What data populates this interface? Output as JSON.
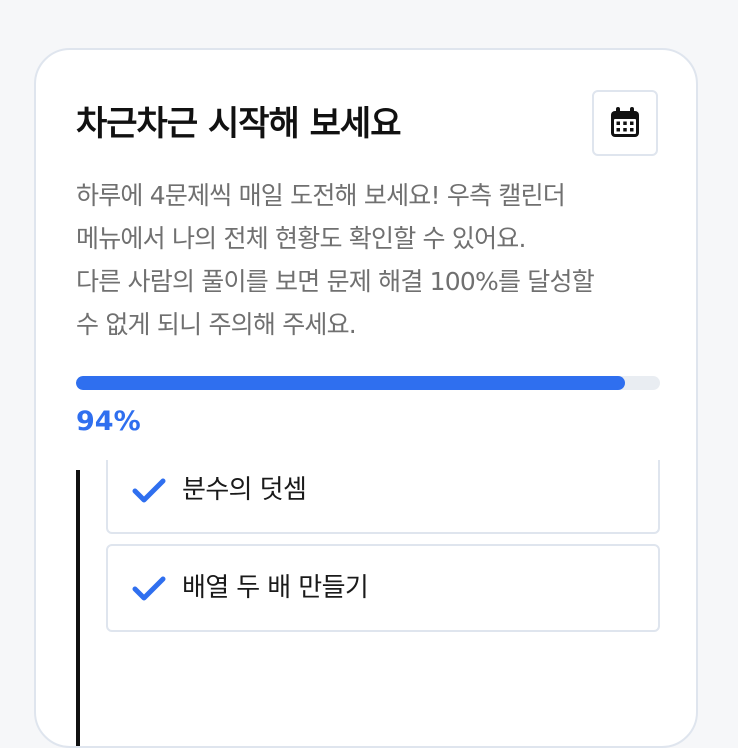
{
  "card": {
    "title": "차근차근 시작해 보세요",
    "calendar_icon": "calendar-icon",
    "description_lines": [
      "하루에 4문제씩 매일 도전해 보세요! 우측 캘린더",
      "메뉴에서 나의 전체 현황도 확인할 수 있어요.",
      "다른 사람의 풀이를 보면 문제 해결 100%를 달성할",
      "수 없게 되니 주의해 주세요."
    ],
    "progress": {
      "value_percent": 94,
      "label": "94%"
    },
    "items": [
      {
        "label": "분수의 덧셈",
        "status": "done"
      },
      {
        "label": "배열 두 배 만들기",
        "status": "done"
      }
    ]
  },
  "colors": {
    "accent": "#2f6fef",
    "border": "#dfe5ee",
    "text_primary": "#111111",
    "text_secondary": "#707070"
  }
}
